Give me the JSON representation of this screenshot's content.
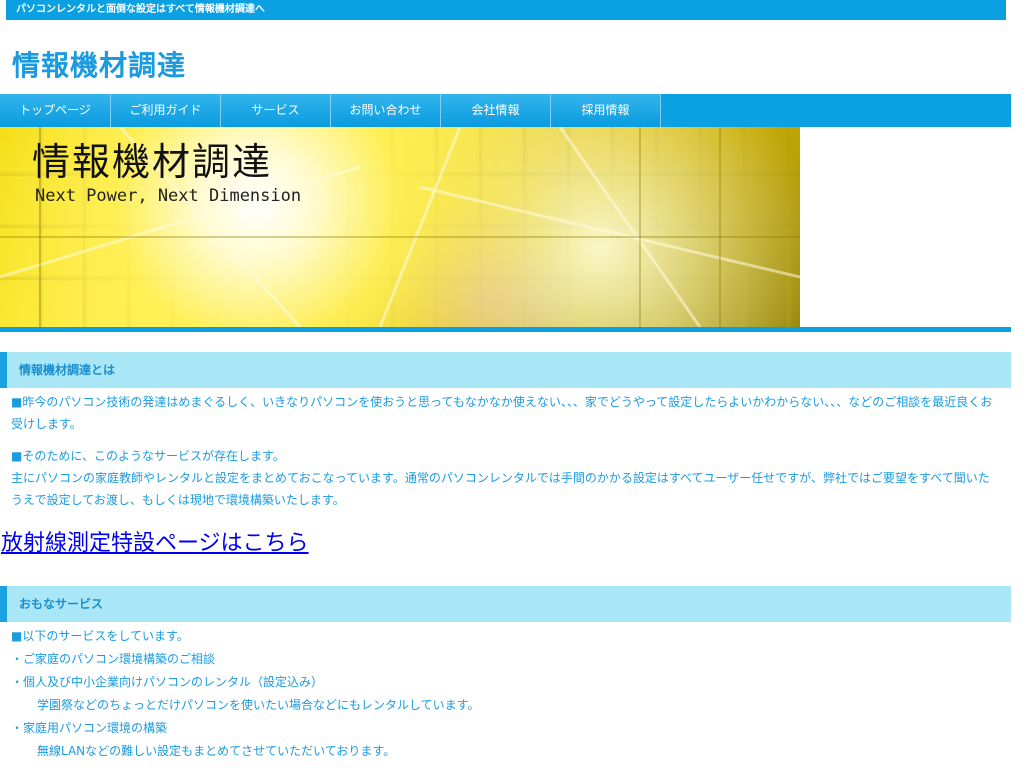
{
  "topbar": {
    "text": "パソコンレンタルと面倒な設定はすべて情報機材調達へ"
  },
  "site": {
    "title": "情報機材調達"
  },
  "nav": {
    "items": [
      {
        "label": "トップページ"
      },
      {
        "label": "ご利用ガイド"
      },
      {
        "label": "サービス"
      },
      {
        "label": "お問い合わせ"
      },
      {
        "label": "会社情報"
      },
      {
        "label": "採用情報"
      }
    ]
  },
  "hero": {
    "title": "情報機材調達",
    "subtitle": "Next Power, Next Dimension"
  },
  "about": {
    "heading": "情報機材調達とは",
    "p1": "■昨今のパソコン技術の発達はめまぐるしく、いきなりパソコンを使おうと思ってもなかなか使えない、、、家でどうやって設定したらよいかわからない、、、などのご相談を最近良くお受けします。",
    "p2_line1": "■そのために、このようなサービスが存在します。",
    "p2_line2": "主にパソコンの家庭教師やレンタルと設定をまとめておこなっています。通常のパソコンレンタルでは手間のかかる設定はすべてユーザー任せですが、弊社ではご要望をすべて聞いたうえで設定してお渡し、もしくは現地で環境構築いたします。"
  },
  "special_link": {
    "label": "放射線測定特設ページはこちら"
  },
  "services": {
    "heading": "おもなサービス",
    "rows": [
      "■以下のサービスをしています。",
      "・ご家庭のパソコン環境構築のご相談",
      "・個人及び中小企業向けパソコンのレンタル（設定込み）",
      "学園祭などのちょっとだけパソコンを使いたい場合などにもレンタルしています。",
      "・家庭用パソコン環境の構築",
      "無線LANなどの難しい設定もまとめてさせていただいております。"
    ]
  },
  "colors": {
    "brand_blue": "#0aa0e2",
    "section_bg": "#a9e6f6",
    "text_blue": "#1b9be0",
    "link": "#0000ee"
  }
}
